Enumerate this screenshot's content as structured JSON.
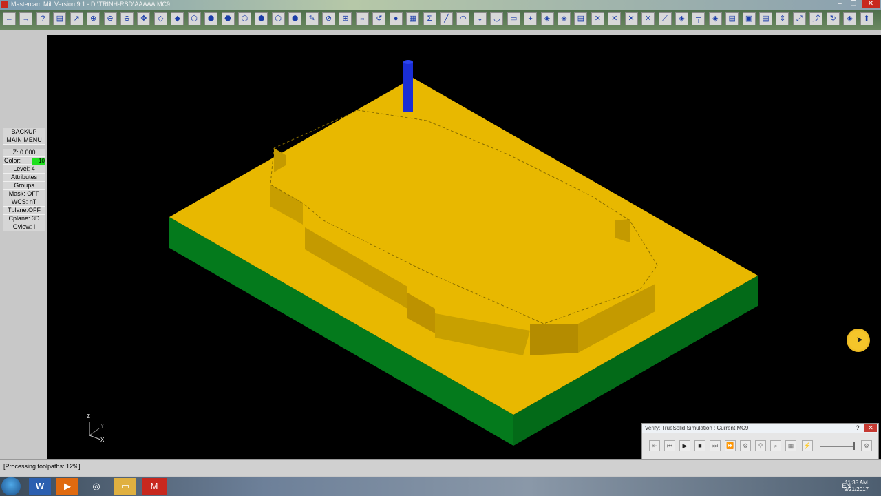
{
  "window": {
    "title": "Mastercam Mill Version 9.1 - D:\\TRINH-RSD\\AAAAA.MC9",
    "minimize": "–",
    "restore": "❐",
    "close": "✕"
  },
  "toolbar": {
    "icons": [
      "back-arrow-icon",
      "forward-arrow-icon",
      "help-icon",
      "window-icon",
      "select-icon",
      "zoom-window-icon",
      "zoom-out-icon",
      "zoom-in-icon",
      "pan-icon",
      "fit-icon",
      "repaint-icon",
      "gview-top-icon",
      "gview-front-icon",
      "gview-side-icon",
      "gview-iso-icon",
      "cplane-icon",
      "tplane-icon",
      "view-icon",
      "pen-icon",
      "no-entry-icon",
      "transform-icon",
      "mirror-icon",
      "undo-icon",
      "sphere-icon",
      "grid-icon",
      "sigma-icon",
      "line-icon",
      "arc-icon",
      "chevron-icon",
      "arc2-icon",
      "rectangle-icon",
      "point-icon",
      "surface-icon",
      "solids-icon",
      "layer-icon",
      "trim-icon",
      "break-icon",
      "extend-icon",
      "modify-icon",
      "xform-icon",
      "toolpath-icon",
      "drill-icon",
      "contour-icon",
      "pocket-icon",
      "face-icon",
      "analyze-icon",
      "dimension-icon",
      "measure-icon",
      "verify-icon",
      "backplot-icon",
      "post-icon",
      "exit-icon"
    ]
  },
  "left_menu": {
    "backup": "BACKUP",
    "main_menu": "MAIN MENU",
    "z": "Z:  0.000",
    "color_label": "Color:",
    "color_value": "10",
    "level": "Level:  4",
    "attributes": "Attributes",
    "groups": "Groups",
    "mask": "Mask:  OFF",
    "wcs": "WCS:  nT",
    "tplane": "Tplane:OFF",
    "cplane": "Cplane: 3D",
    "gview": "Gview:  I"
  },
  "viewport": {
    "axis_z": "Z",
    "axis_y": "Y",
    "axis_x": "X",
    "colors": {
      "part_top": "#e8b800",
      "part_side": "#047a1c",
      "wall": "#c49a00",
      "tool": "#1a2ed6"
    }
  },
  "status": {
    "text": "[Processing toolpaths:   12%]"
  },
  "verify_dialog": {
    "title": "Verify: TrueSolid Simulation : Current MC9",
    "help": "?",
    "close": "✕",
    "buttons": [
      "reset-icon",
      "rewind-icon",
      "play-icon",
      "stop-icon",
      "step-icon",
      "fast-forward-icon",
      "options-icon",
      "tool-icon",
      "zoom-icon",
      "machine-icon",
      "speed-icon",
      "config-icon"
    ]
  },
  "taskbar": {
    "apps": [
      "word-icon",
      "media-player-icon",
      "chrome-icon",
      "file-explorer-icon",
      "mastercam-icon"
    ],
    "language": "EN",
    "time": "11:35 AM",
    "date": "9/21/2017"
  }
}
